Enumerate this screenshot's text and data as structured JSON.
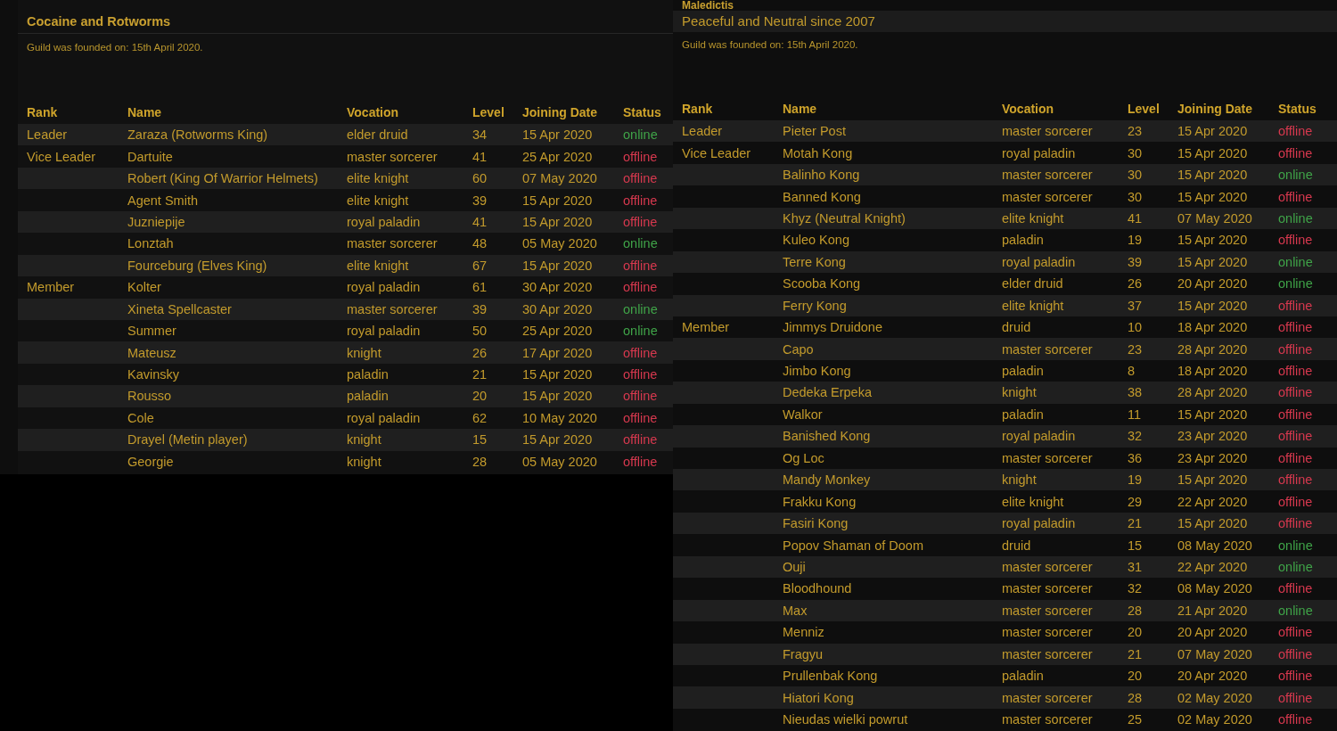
{
  "guilds": [
    {
      "title": "Cocaine and Rotworms",
      "founded": "Guild was founded on: 15th April 2020.",
      "columns": [
        "Rank",
        "Name",
        "Vocation",
        "Level",
        "Joining Date",
        "Status"
      ],
      "members": [
        {
          "rank": "Leader",
          "name": "Zaraza (Rotworms King)",
          "vocation": "elder druid",
          "char_level": "34",
          "joined": "15 Apr 2020",
          "status": "online",
          "online": true
        },
        {
          "rank": "Vice Leader",
          "name": "Dartuite",
          "vocation": "master sorcerer",
          "char_level": "41",
          "joined": "25 Apr 2020",
          "status": "offline",
          "online": false
        },
        {
          "name": "Robert (King Of Warrior Helmets)",
          "vocation": "elite knight",
          "char_level": "60",
          "joined": "07 May 2020",
          "status": "offline",
          "online": false
        },
        {
          "name": "Agent Smith",
          "vocation": "elite knight",
          "char_level": "39",
          "joined": "15 Apr 2020",
          "status": "offline",
          "online": false
        },
        {
          "name": "Juzniepije",
          "vocation": "royal paladin",
          "char_level": "41",
          "joined": "15 Apr 2020",
          "status": "offline",
          "online": false
        },
        {
          "name": "Lonztah",
          "vocation": "master sorcerer",
          "char_level": "48",
          "joined": "05 May 2020",
          "status": "online",
          "online": true
        },
        {
          "name": "Fourceburg (Elves King)",
          "vocation": "elite knight",
          "char_level": "67",
          "joined": "15 Apr 2020",
          "status": "offline",
          "online": false
        },
        {
          "rank": "Member",
          "name": "Kolter",
          "vocation": "royal paladin",
          "char_level": "61",
          "joined": "30 Apr 2020",
          "status": "offline",
          "online": false
        },
        {
          "name": "Xineta Spellcaster",
          "vocation": "master sorcerer",
          "char_level": "39",
          "joined": "30 Apr 2020",
          "status": "online",
          "online": true
        },
        {
          "name": "Summer",
          "vocation": "royal paladin",
          "char_level": "50",
          "joined": "25 Apr 2020",
          "status": "online",
          "online": true
        },
        {
          "name": "Mateusz",
          "vocation": "knight",
          "char_level": "26",
          "joined": "17 Apr 2020",
          "status": "offline",
          "online": false
        },
        {
          "name": "Kavinsky",
          "vocation": "paladin",
          "char_level": "21",
          "joined": "15 Apr 2020",
          "status": "offline",
          "online": false
        },
        {
          "name": "Rousso",
          "vocation": "paladin",
          "char_level": "20",
          "joined": "15 Apr 2020",
          "status": "offline",
          "online": false
        },
        {
          "name": "Cole",
          "vocation": "royal paladin",
          "char_level": "62",
          "joined": "10 May 2020",
          "status": "offline",
          "online": false
        },
        {
          "name": "Drayel (Metin player)",
          "vocation": "knight",
          "char_level": "15",
          "joined": "15 Apr 2020",
          "status": "offline",
          "online": false
        },
        {
          "name": "Georgie",
          "vocation": "knight",
          "char_level": "28",
          "joined": "05 May 2020",
          "status": "offline",
          "online": false
        }
      ]
    },
    {
      "title": "Maledictis",
      "description": "Peaceful and Neutral since 2007",
      "founded": "Guild was founded on: 15th April 2020.",
      "columns": [
        "Rank",
        "Name",
        "Vocation",
        "Level",
        "Joining Date",
        "Status"
      ],
      "members": [
        {
          "rank": "Leader",
          "name": "Pieter Post",
          "vocation": "master sorcerer",
          "char_level": "23",
          "joined": "15 Apr 2020",
          "status": "offline",
          "online": false
        },
        {
          "rank": "Vice Leader",
          "name": "Motah Kong",
          "vocation": "royal paladin",
          "char_level": "30",
          "joined": "15 Apr 2020",
          "status": "offline",
          "online": false
        },
        {
          "name": "Balinho Kong",
          "vocation": "master sorcerer",
          "char_level": "30",
          "joined": "15 Apr 2020",
          "status": "online",
          "online": true
        },
        {
          "name": "Banned Kong",
          "vocation": "master sorcerer",
          "char_level": "30",
          "joined": "15 Apr 2020",
          "status": "offline",
          "online": false
        },
        {
          "name": "Khyz (Neutral Knight)",
          "vocation": "elite knight",
          "char_level": "41",
          "joined": "07 May 2020",
          "status": "online",
          "online": true
        },
        {
          "name": "Kuleo Kong",
          "vocation": "paladin",
          "char_level": "19",
          "joined": "15 Apr 2020",
          "status": "offline",
          "online": false
        },
        {
          "name": "Terre Kong",
          "vocation": "royal paladin",
          "char_level": "39",
          "joined": "15 Apr 2020",
          "status": "online",
          "online": true
        },
        {
          "name": "Scooba Kong",
          "vocation": "elder druid",
          "char_level": "26",
          "joined": "20 Apr 2020",
          "status": "online",
          "online": true
        },
        {
          "name": "Ferry Kong",
          "vocation": "elite knight",
          "char_level": "37",
          "joined": "15 Apr 2020",
          "status": "offline",
          "online": false
        },
        {
          "rank": "Member",
          "name": "Jimmys Druidone",
          "vocation": "druid",
          "char_level": "10",
          "joined": "18 Apr 2020",
          "status": "offline",
          "online": false
        },
        {
          "name": "Capo",
          "vocation": "master sorcerer",
          "char_level": "23",
          "joined": "28 Apr 2020",
          "status": "offline",
          "online": false
        },
        {
          "name": "Jimbo Kong",
          "vocation": "paladin",
          "char_level": "8",
          "joined": "18 Apr 2020",
          "status": "offline",
          "online": false
        },
        {
          "name": "Dedeka Erpeka",
          "vocation": "knight",
          "char_level": "38",
          "joined": "28 Apr 2020",
          "status": "offline",
          "online": false
        },
        {
          "name": "Walkor",
          "vocation": "paladin",
          "char_level": "11",
          "joined": "15 Apr 2020",
          "status": "offline",
          "online": false
        },
        {
          "name": "Banished Kong",
          "vocation": "royal paladin",
          "char_level": "32",
          "joined": "23 Apr 2020",
          "status": "offline",
          "online": false
        },
        {
          "name": "Og Loc",
          "vocation": "master sorcerer",
          "char_level": "36",
          "joined": "23 Apr 2020",
          "status": "offline",
          "online": false
        },
        {
          "name": "Mandy Monkey",
          "vocation": "knight",
          "char_level": "19",
          "joined": "15 Apr 2020",
          "status": "offline",
          "online": false
        },
        {
          "name": "Frakku Kong",
          "vocation": "elite knight",
          "char_level": "29",
          "joined": "22 Apr 2020",
          "status": "offline",
          "online": false
        },
        {
          "name": "Fasiri Kong",
          "vocation": "royal paladin",
          "char_level": "21",
          "joined": "15 Apr 2020",
          "status": "offline",
          "online": false
        },
        {
          "name": "Popov Shaman of Doom",
          "vocation": "druid",
          "char_level": "15",
          "joined": "08 May 2020",
          "status": "online",
          "online": true
        },
        {
          "name": "Ouji",
          "vocation": "master sorcerer",
          "char_level": "31",
          "joined": "22 Apr 2020",
          "status": "online",
          "online": true
        },
        {
          "name": "Bloodhound",
          "vocation": "master sorcerer",
          "char_level": "32",
          "joined": "08 May 2020",
          "status": "offline",
          "online": false
        },
        {
          "name": "Max",
          "vocation": "master sorcerer",
          "char_level": "28",
          "joined": "21 Apr 2020",
          "status": "online",
          "online": true
        },
        {
          "name": "Menniz",
          "vocation": "master sorcerer",
          "char_level": "20",
          "joined": "20 Apr 2020",
          "status": "offline",
          "online": false
        },
        {
          "name": "Fragyu",
          "vocation": "master sorcerer",
          "char_level": "21",
          "joined": "07 May 2020",
          "status": "offline",
          "online": false
        },
        {
          "name": "Prullenbak Kong",
          "vocation": "paladin",
          "char_level": "20",
          "joined": "20 Apr 2020",
          "status": "offline",
          "online": false
        },
        {
          "name": "Hiatori Kong",
          "vocation": "master sorcerer",
          "char_level": "28",
          "joined": "02 May 2020",
          "status": "offline",
          "online": false
        },
        {
          "name": "Nieudas wielki powrut",
          "vocation": "master sorcerer",
          "char_level": "25",
          "joined": "02 May 2020",
          "status": "offline",
          "online": false
        }
      ]
    }
  ]
}
